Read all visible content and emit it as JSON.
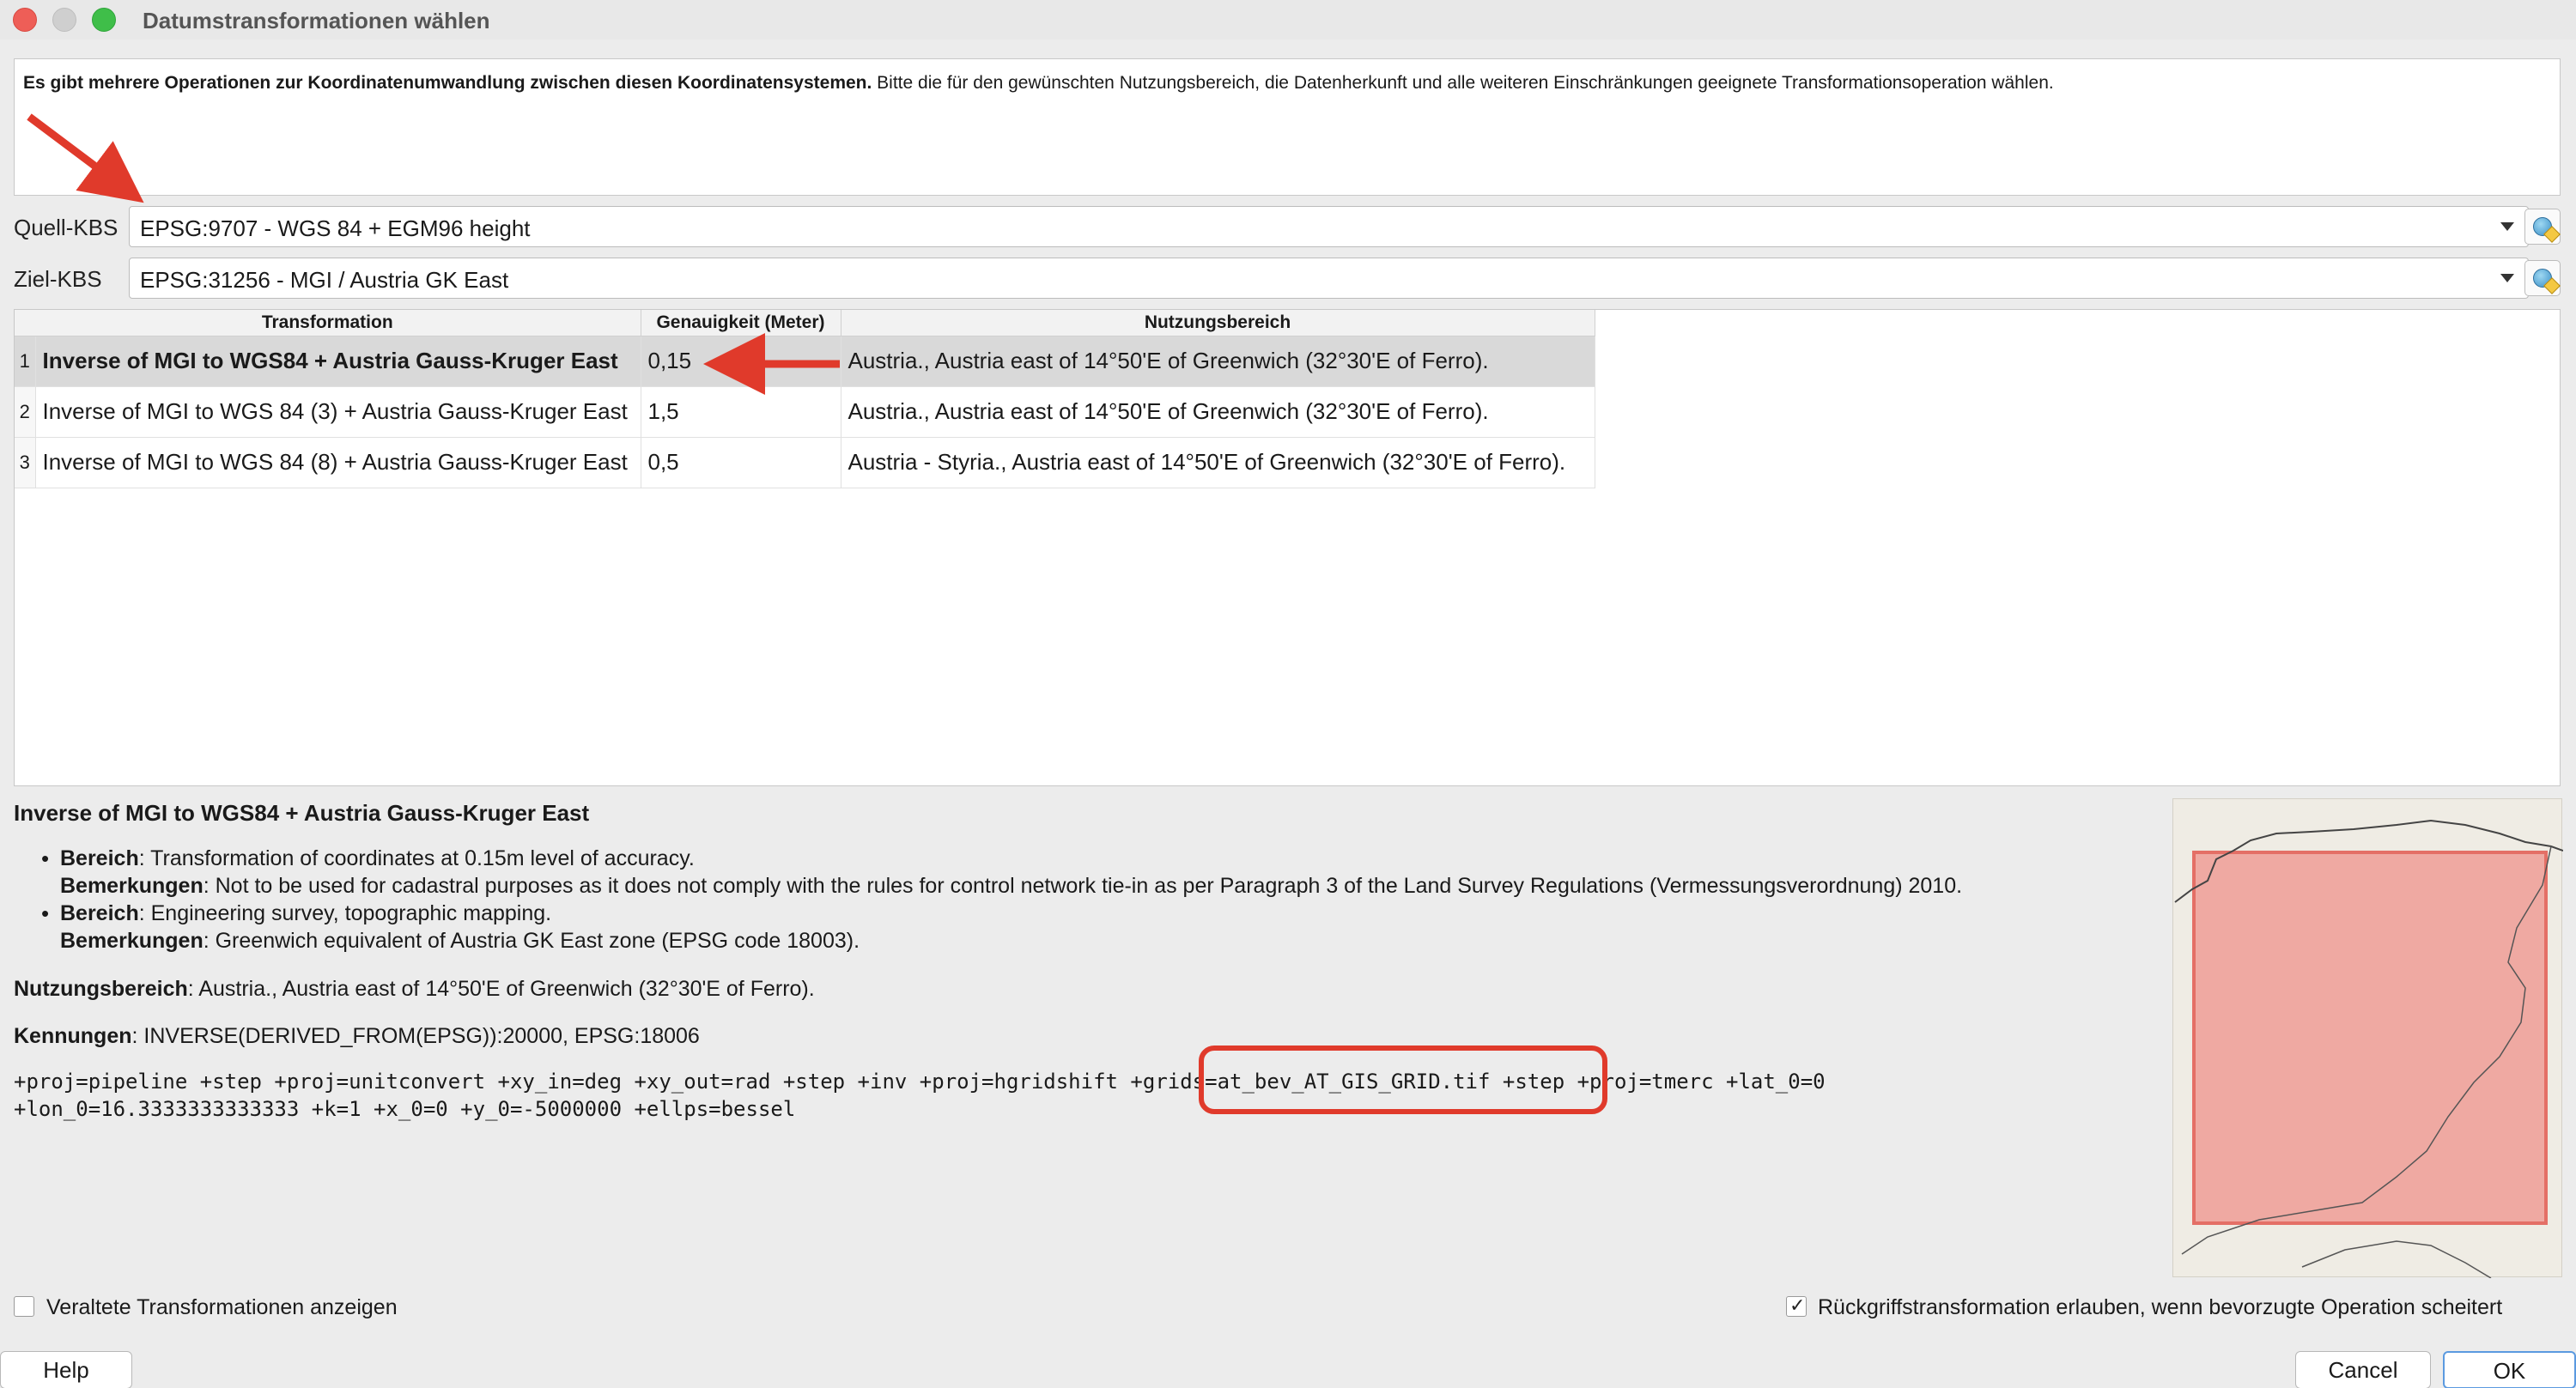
{
  "window": {
    "title": "Datumstransformationen wählen"
  },
  "info": {
    "bold": "Es gibt mehrere Operationen zur Koordinatenumwandlung zwischen diesen Koordinatensystemen.",
    "text": " Bitte die für den gewünschten Nutzungsbereich, die Datenherkunft und alle weiteren Einschränkungen geeignete Transformationsoperation wählen."
  },
  "source_crs": {
    "label": "Quell-KBS",
    "value": "EPSG:9707 - WGS 84 + EGM96 height"
  },
  "target_crs": {
    "label": "Ziel-KBS",
    "value": "EPSG:31256 - MGI / Austria GK East"
  },
  "table": {
    "headers": [
      "Transformation",
      "Genauigkeit (Meter)",
      "Nutzungsbereich"
    ],
    "rows": [
      {
        "num": "1",
        "transformation": "Inverse of MGI to WGS84 + Austria Gauss-Kruger East",
        "accuracy": "0,15",
        "area": "Austria., Austria east of 14°50'E of Greenwich (32°30'E of Ferro)."
      },
      {
        "num": "2",
        "transformation": "Inverse of MGI to WGS 84 (3) + Austria Gauss-Kruger East",
        "accuracy": "1,5",
        "area": "Austria., Austria east of 14°50'E of Greenwich (32°30'E of Ferro)."
      },
      {
        "num": "3",
        "transformation": "Inverse of MGI to WGS 84 (8) + Austria Gauss-Kruger East",
        "accuracy": "0,5",
        "area": "Austria - Styria., Austria east of 14°50'E of Greenwich (32°30'E of Ferro)."
      }
    ]
  },
  "details": {
    "title": "Inverse of MGI to WGS84 + Austria Gauss-Kruger East",
    "items": [
      {
        "scope_label": "Bereich",
        "scope": ": Transformation of coordinates at 0.15m level of accuracy.",
        "remarks_label": "Bemerkungen",
        "remarks": ": Not to be used for cadastral purposes as it does not comply with the rules for control network tie-in as per Paragraph 3 of the Land Survey Regulations (Vermessungsverordnung) 2010."
      },
      {
        "scope_label": "Bereich",
        "scope": ": Engineering survey, topographic mapping.",
        "remarks_label": "Bemerkungen",
        "remarks": ": Greenwich equivalent of Austria GK East zone (EPSG code 18003)."
      }
    ],
    "area_label": "Nutzungsbereich",
    "area": ": Austria., Austria east of 14°50'E of Greenwich (32°30'E of Ferro).",
    "ids_label": "Kennungen",
    "ids": ": INVERSE(DERIVED_FROM(EPSG)):20000, EPSG:18006",
    "proj_line1": "+proj=pipeline +step +proj=unitconvert +xy_in=deg +xy_out=rad +step +inv +proj=hgridshift +grids=at_bev_AT_GIS_GRID.tif +step +proj=tmerc +lat_0=0",
    "proj_line2": "+lon_0=16.3333333333333 +k=1 +x_0=0 +y_0=-5000000 +ellps=bessel"
  },
  "options": {
    "show_deprecated": "Veraltete Transformationen anzeigen",
    "show_deprecated_checked": false,
    "allow_fallback": "Rückgriffstransformation erlauben, wenn bevorzugte Operation scheitert",
    "allow_fallback_checked": true
  },
  "buttons": {
    "help": "Help",
    "cancel": "Cancel",
    "ok": "OK"
  },
  "colors": {
    "annotation_red": "#e03a2b",
    "map_extent_fill": "#efa9a2",
    "selected_row": "#d9d9d9"
  }
}
